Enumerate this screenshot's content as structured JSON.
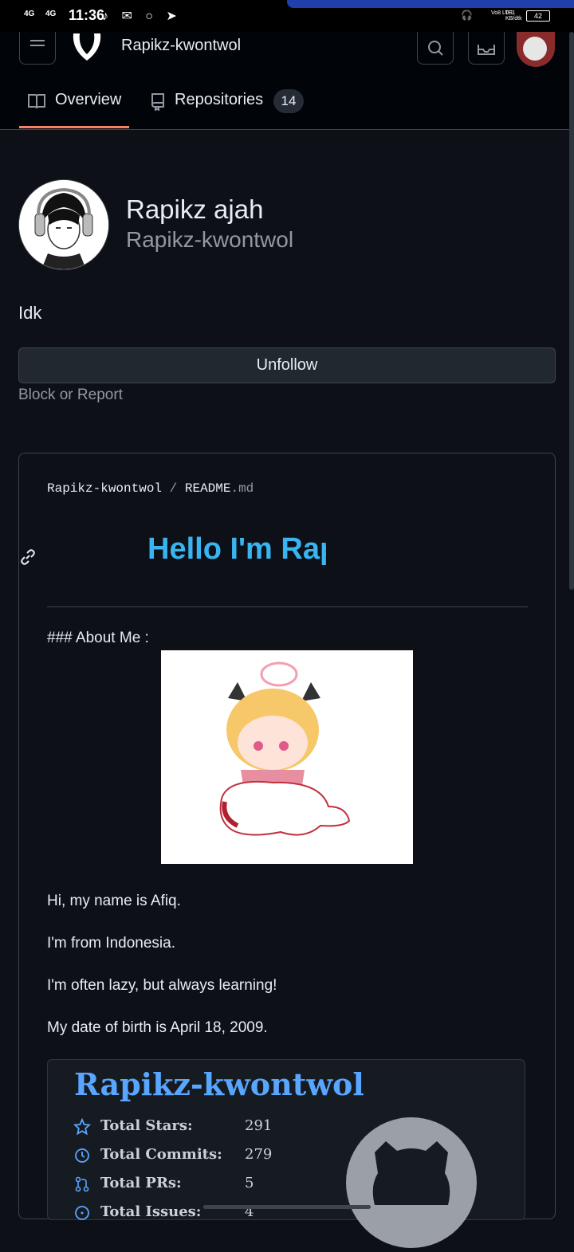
{
  "status_bar": {
    "network1": "4G",
    "network2": "4G",
    "time": "11:36",
    "speed": "0.1 KB/dtk",
    "net_label": "Vo8 LTE1",
    "battery": "42"
  },
  "header": {
    "username": "Rapikz-kwontwol"
  },
  "tabs": [
    {
      "label": "Overview"
    },
    {
      "label": "Repositories",
      "count": "14"
    }
  ],
  "profile": {
    "name": "Rapikz ajah",
    "login": "Rapikz-kwontwol",
    "bio": "Idk",
    "unfollow_label": "Unfollow",
    "block_label": "Block or Report"
  },
  "readme": {
    "owner": "Rapikz-kwontwol",
    "separator": "/",
    "file_base": "README",
    "file_ext": ".md",
    "hello_text": "Hello I'm Rapikz",
    "about_heading": "### About Me :",
    "paragraphs": [
      "Hi, my name is Afiq.",
      "I'm from Indonesia.",
      "I'm often lazy, but always learning!",
      "My date of birth is April 18, 2009."
    ]
  },
  "stats_card": {
    "title": "Rapikz-kwontwol",
    "rows": [
      {
        "label": "Total Stars:",
        "value": "291",
        "icon": "star-icon"
      },
      {
        "label": "Total Commits:",
        "value": "279",
        "icon": "history-icon"
      },
      {
        "label": "Total PRs:",
        "value": "5",
        "icon": "pull-request-icon"
      },
      {
        "label": "Total Issues:",
        "value": "4",
        "icon": "issue-icon"
      }
    ]
  },
  "colors": {
    "accent_underline": "#f78166",
    "hello_blue": "#38b5f0",
    "card_title": "#58a6ff"
  }
}
